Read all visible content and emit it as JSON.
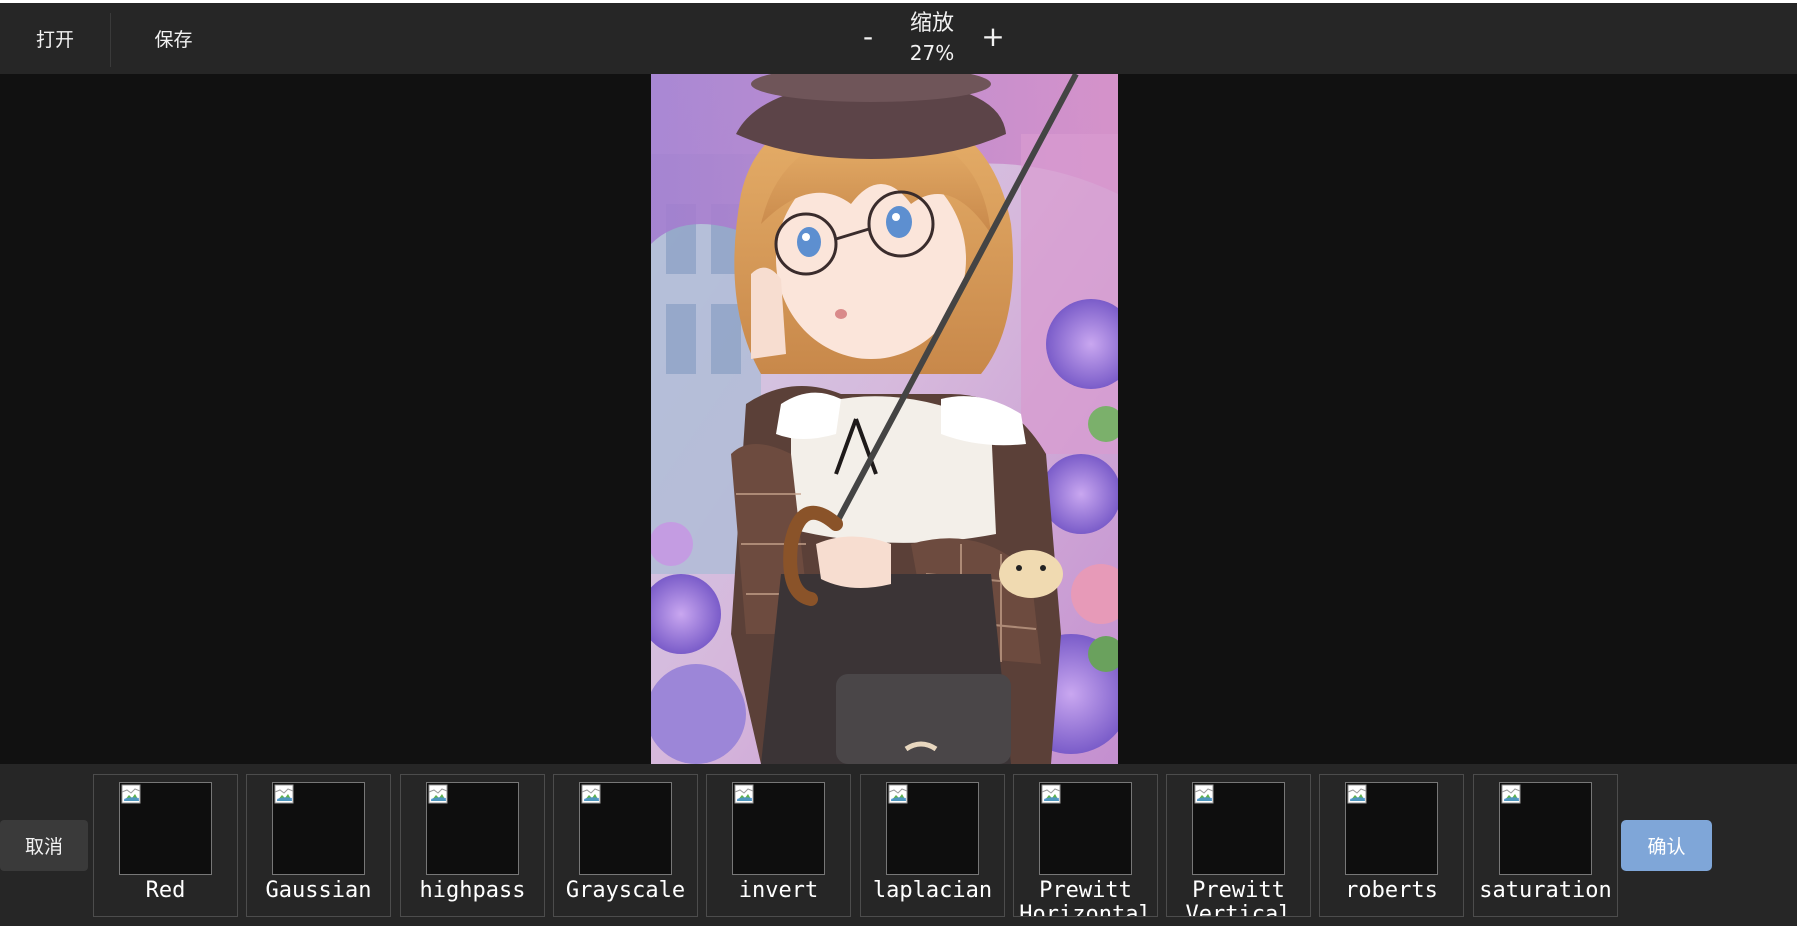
{
  "toolbar": {
    "open_label": "打开",
    "save_label": "保存",
    "zoom": {
      "title": "缩放",
      "value": "27%",
      "minus_label": "-",
      "plus_label": "+"
    }
  },
  "filters": [
    {
      "label": "Red"
    },
    {
      "label": "Gaussian"
    },
    {
      "label": "highpass"
    },
    {
      "label": "Grayscale"
    },
    {
      "label": "invert"
    },
    {
      "label": "laplacian"
    },
    {
      "label": "Prewitt Horizontal"
    },
    {
      "label": "Prewitt Vertical"
    },
    {
      "label": "roberts"
    },
    {
      "label": "saturation"
    }
  ],
  "actions": {
    "cancel_label": "取消",
    "confirm_label": "确认"
  },
  "colors": {
    "toolbar_bg": "#262626",
    "canvas_bg": "#111111",
    "confirm_bg": "#7fa6d8",
    "cancel_bg": "#3a3a3a"
  }
}
